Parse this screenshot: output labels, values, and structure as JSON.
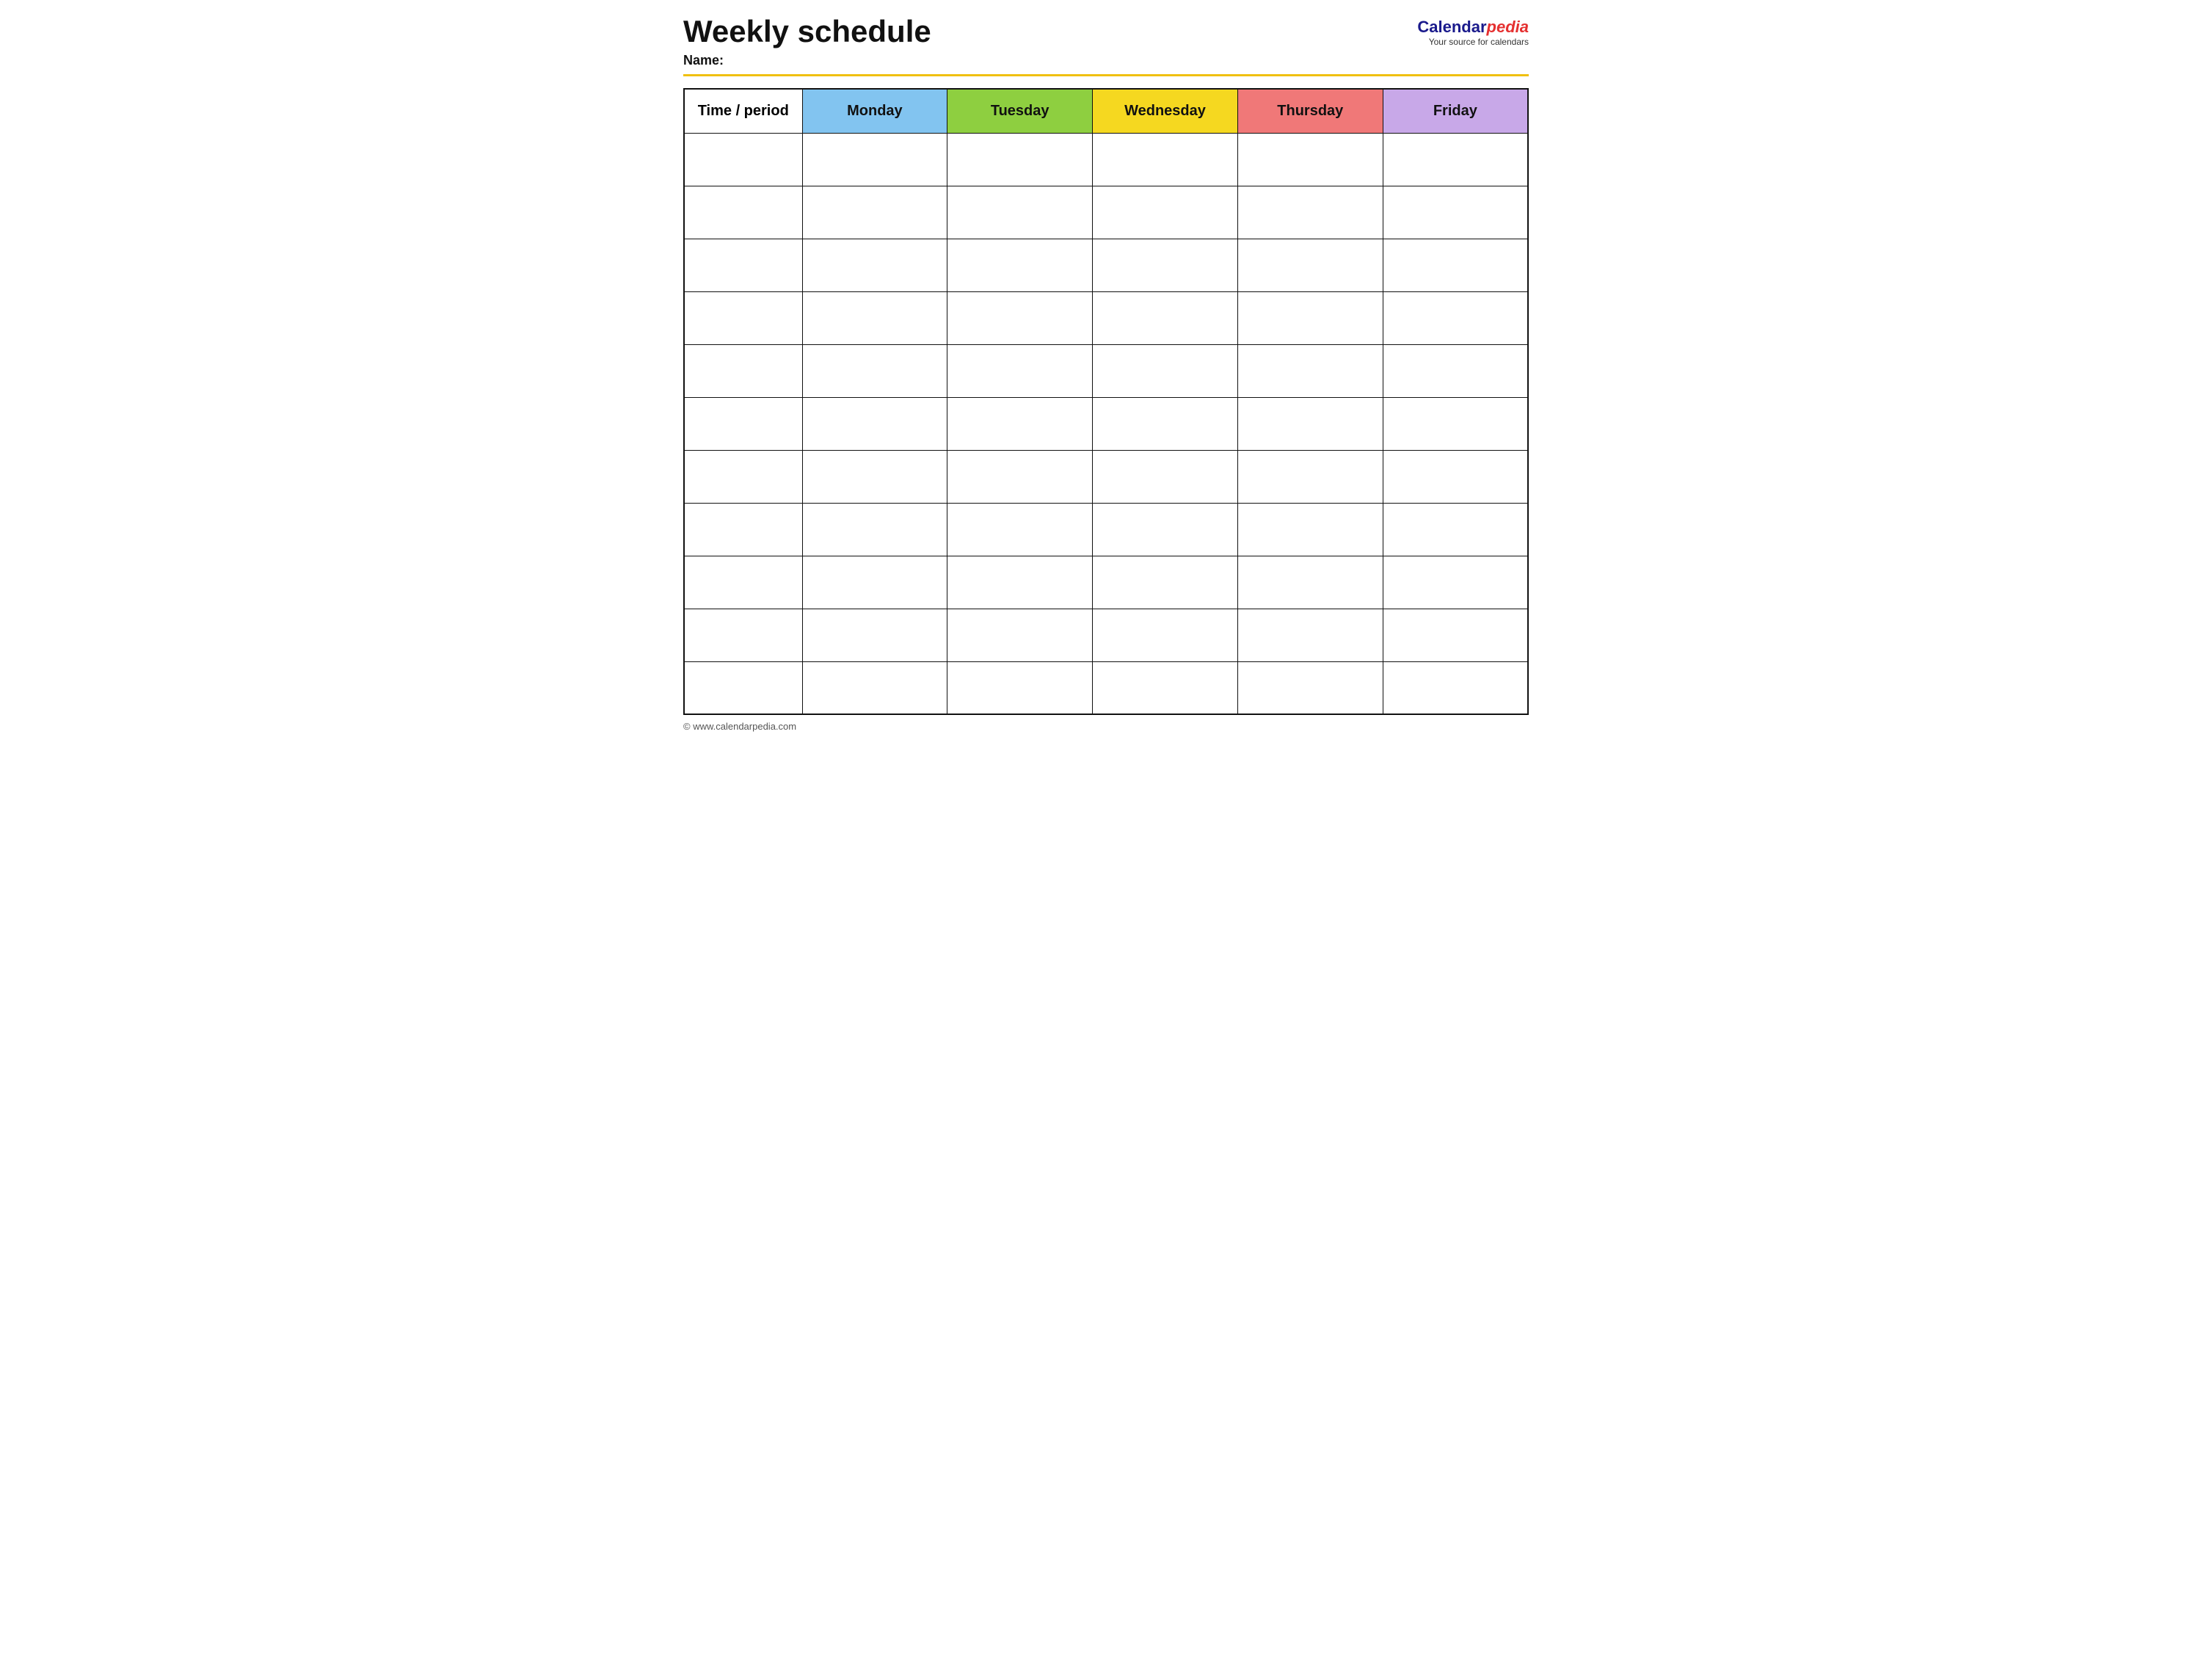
{
  "header": {
    "title": "Weekly schedule",
    "name_label": "Name:",
    "logo_calendar": "Calendar",
    "logo_pedia": "pedia",
    "logo_subtitle": "Your source for calendars"
  },
  "table": {
    "columns": [
      {
        "id": "time",
        "label": "Time / period",
        "color": "#fff",
        "class": "th-time"
      },
      {
        "id": "monday",
        "label": "Monday",
        "color": "#82c4f0",
        "class": "th-monday"
      },
      {
        "id": "tuesday",
        "label": "Tuesday",
        "color": "#8ecf40",
        "class": "th-tuesday"
      },
      {
        "id": "wednesday",
        "label": "Wednesday",
        "color": "#f5d820",
        "class": "th-wednesday"
      },
      {
        "id": "thursday",
        "label": "Thursday",
        "color": "#f07878",
        "class": "th-thursday"
      },
      {
        "id": "friday",
        "label": "Friday",
        "color": "#c8a8e8",
        "class": "th-friday"
      }
    ],
    "row_count": 11
  },
  "footer": {
    "url": "© www.calendarpedia.com"
  }
}
